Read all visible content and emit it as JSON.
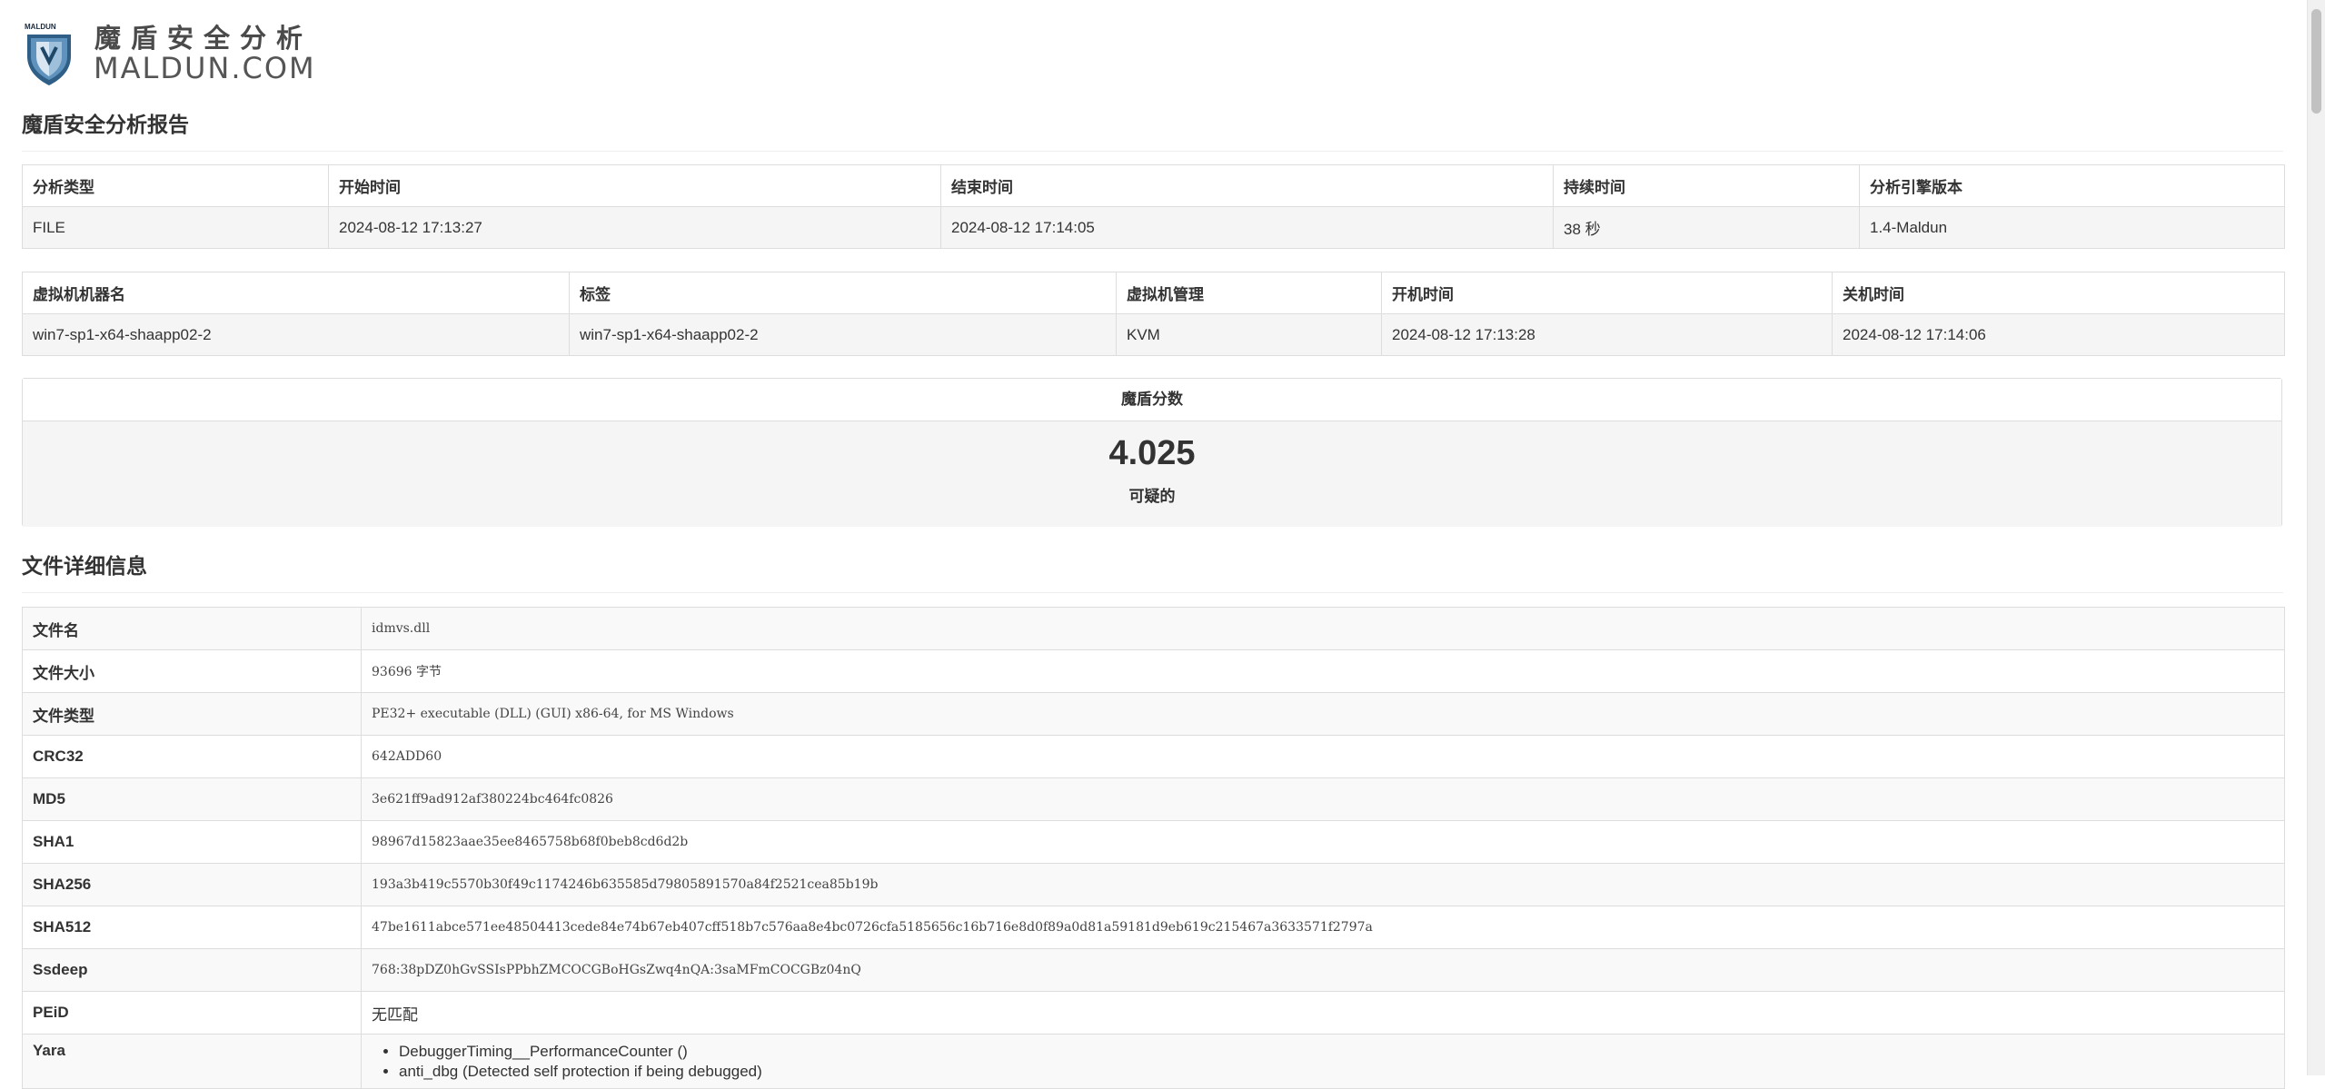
{
  "logo": {
    "small_text": "MALDUN",
    "cn_text": "魔盾安全分析",
    "en_text": "MALDUN.COM"
  },
  "report_title": "魔盾安全分析报告",
  "analysis_table": {
    "headers": [
      "分析类型",
      "开始时间",
      "结束时间",
      "持续时间",
      "分析引擎版本"
    ],
    "values": [
      "FILE",
      "2024-08-12 17:13:27",
      "2024-08-12 17:14:05",
      "38 秒",
      "1.4-Maldun"
    ]
  },
  "vm_table": {
    "headers": [
      "虚拟机机器名",
      "标签",
      "虚拟机管理",
      "开机时间",
      "关机时间"
    ],
    "values": [
      "win7-sp1-x64-shaapp02-2",
      "win7-sp1-x64-shaapp02-2",
      "KVM",
      "2024-08-12 17:13:28",
      "2024-08-12 17:14:06"
    ]
  },
  "score": {
    "heading": "魔盾分数",
    "value": "4.025",
    "verdict": "可疑的"
  },
  "file_details_title": "文件详细信息",
  "file_details": [
    {
      "label": "文件名",
      "value": "idmvs.dll"
    },
    {
      "label": "文件大小",
      "value": "93696 字节"
    },
    {
      "label": "文件类型",
      "value": "PE32+ executable (DLL) (GUI) x86-64, for MS Windows"
    },
    {
      "label": "CRC32",
      "value": "642ADD60"
    },
    {
      "label": "MD5",
      "value": "3e621ff9ad912af380224bc464fc0826"
    },
    {
      "label": "SHA1",
      "value": "98967d15823aae35ee8465758b68f0beb8cd6d2b"
    },
    {
      "label": "SHA256",
      "value": "193a3b419c5570b30f49c1174246b635585d79805891570a84f2521cea85b19b"
    },
    {
      "label": "SHA512",
      "value": "47be1611abce571ee48504413cede84e74b67eb407cff518b7c576aa8e4bc0726cfa5185656c16b716e8d0f89a0d81a59181d9eb619c215467a3633571f2797a"
    },
    {
      "label": "Ssdeep",
      "value": "768:38pDZ0hGvSSIsPPbhZMCOCGBoHGsZwq4nQA:3saMFmCOCGBz04nQ"
    },
    {
      "label": "PEiD",
      "value": "无匹配"
    },
    {
      "label": "Yara",
      "items": [
        "DebuggerTiming__PerformanceCounter ()",
        "anti_dbg (Detected self protection if being debugged)"
      ]
    }
  ]
}
